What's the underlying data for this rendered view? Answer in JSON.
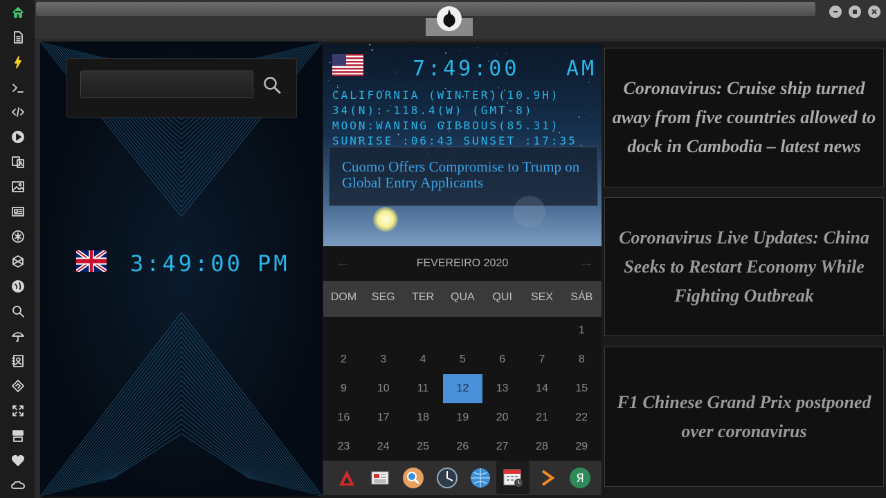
{
  "sidebar": {
    "icons": [
      "home-icon",
      "document-icon",
      "lightning-icon",
      "terminal-icon",
      "code-icon",
      "play-icon",
      "translate-icon",
      "image-icon",
      "newspaper-icon",
      "asterisk-icon",
      "hexagon-icon",
      "globe-icon",
      "search-icon",
      "umbrella-icon",
      "contacts-icon",
      "tag-icon",
      "expand-icon",
      "youtube-icon",
      "heart-icon",
      "cloud-icon"
    ]
  },
  "search": {
    "placeholder": ""
  },
  "clocks": {
    "uk": {
      "time": "3:49:00",
      "ampm": "PM"
    },
    "us": {
      "time": "7:49:00",
      "ampm": "AM"
    }
  },
  "weather": {
    "line1": "CALIFORNIA (WINTER)(10.9H)",
    "line2": "34(N):-118.4(W) (GMT-8)",
    "line3": "MOON:WANING GIBBOUS(85.31)",
    "line4": "SUNRISE_:06:43 SUNSET_:17:35"
  },
  "headline": "Cuomo Offers Compromise to Trump on Global Entry Applicants",
  "calendar": {
    "month": "FEVEREIRO 2020",
    "daynames": [
      "DOM",
      "SEG",
      "TER",
      "QUA",
      "QUI",
      "SEX",
      "SÁB"
    ],
    "weeks": [
      [
        "",
        "",
        "",
        "",
        "",
        "",
        "1"
      ],
      [
        "2",
        "3",
        "4",
        "5",
        "6",
        "7",
        "8"
      ],
      [
        "9",
        "10",
        "11",
        "12",
        "13",
        "14",
        "15"
      ],
      [
        "16",
        "17",
        "18",
        "19",
        "20",
        "21",
        "22"
      ],
      [
        "23",
        "24",
        "25",
        "26",
        "27",
        "28",
        "29"
      ]
    ],
    "today": "12"
  },
  "dock": {
    "apps": [
      "app-launcher-icon",
      "news-reader-icon",
      "search-app-icon",
      "clock-app-icon",
      "browser-icon",
      "calendar-icon",
      "arrow-app-icon",
      "yandex-icon"
    ]
  },
  "news": [
    {
      "title": "Coronavirus: Cruise ship turned away from five countries allowed to dock in Cambodia – latest news",
      "color": "#aaaaaa"
    },
    {
      "title": "Coronavirus Live Updates: China Seeks to Restart Economy While Fighting Outbreak",
      "color": "#9a9a9a"
    },
    {
      "title": "F1 Chinese Grand Prix postponed over coronavirus",
      "color": "#9a9a9a"
    }
  ],
  "colors": {
    "accent": "#29b6e8",
    "today": "#4a90d9",
    "headline": "#3aa2e6",
    "home": "#3ec06d"
  }
}
